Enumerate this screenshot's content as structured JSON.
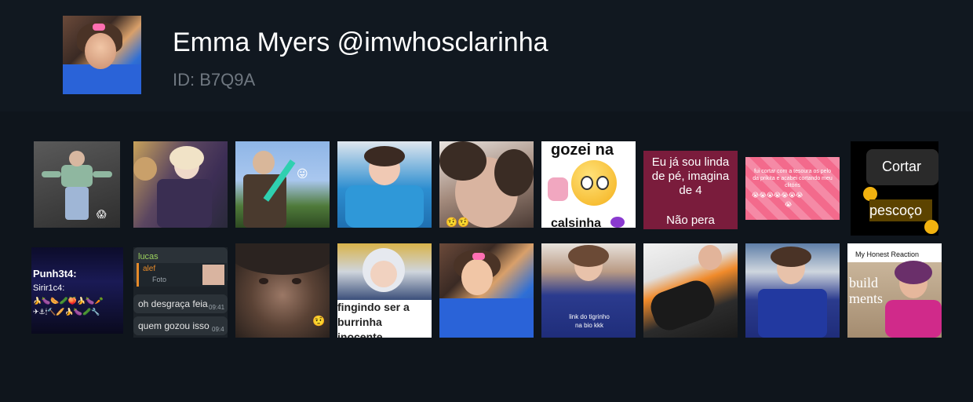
{
  "profile": {
    "title": "Emma Myers @imwhosclarinha",
    "id_label": "ID: B7Q9A"
  },
  "stickers": {
    "row1": [
      {
        "name": "sticker-lying-girl"
      },
      {
        "name": "sticker-two-girls"
      },
      {
        "name": "sticker-minecraft-sword"
      },
      {
        "name": "sticker-blue-hoodie"
      },
      {
        "name": "sticker-close-face"
      },
      {
        "name": "sticker-gozei-na-calsinha",
        "top_text": "gozei na",
        "bottom_text": "calsinha"
      },
      {
        "name": "sticker-eu-ja-sou-linda",
        "text_1": "Eu já sou linda de pé, imagina de 4",
        "text_2": "Não pera"
      },
      {
        "name": "sticker-fui-cortar",
        "text": "fui cortar com a tesoura os pelo da prikita e acabei cortando meu clitóris"
      },
      {
        "name": "sticker-cortar-pescoco",
        "text_1": "Cortar",
        "text_2": "pescoço"
      }
    ],
    "row2": [
      {
        "name": "sticker-punh3t4",
        "text_1": "Punh3t4:",
        "text_2": "Sirir1c4:"
      },
      {
        "name": "sticker-chat",
        "sender": "lucas",
        "reply_name": "alef",
        "reply_label": "Foto",
        "msg1": "oh desgraça feia",
        "time1": "09:41",
        "msg2": "quem gozou isso",
        "time2": "09:4"
      },
      {
        "name": "sticker-face-closeup"
      },
      {
        "name": "sticker-fingindo",
        "text": "fingindo ser a burrinha inocente"
      },
      {
        "name": "sticker-car-selfie"
      },
      {
        "name": "sticker-link-do-tigrinho",
        "text": "link do tigrinho na bio kkk"
      },
      {
        "name": "sticker-sneaker"
      },
      {
        "name": "sticker-blue-suit"
      },
      {
        "name": "sticker-my-honest-reaction",
        "text": "My Honest Reaction",
        "bg_text": "build ments"
      }
    ]
  }
}
